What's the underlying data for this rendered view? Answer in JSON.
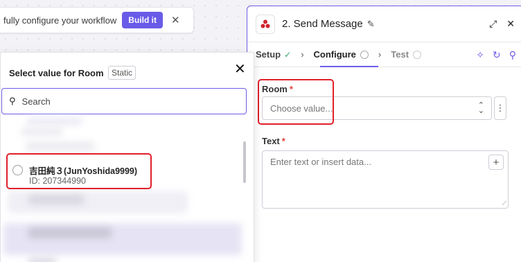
{
  "banner": {
    "text": "fully configure your workflow",
    "build_label": "Build it",
    "close_label": "✕"
  },
  "panel": {
    "step_title": "2. Send Message",
    "tabs": [
      {
        "label": "Setup",
        "state": "done"
      },
      {
        "label": "Configure",
        "state": "active"
      },
      {
        "label": "Test",
        "state": "pending"
      }
    ],
    "room_label": "Room",
    "room_placeholder": "Choose value...",
    "text_label": "Text",
    "text_placeholder": "Enter text or insert data...",
    "required_mark": "*"
  },
  "dropdown": {
    "title": "Select value for Room",
    "static_label": "Static",
    "close_label": "✕",
    "search_placeholder": "Search",
    "selected_option": {
      "name": "吉田純３(JunYoshida9999)",
      "id": "ID: 207344990"
    }
  },
  "colors": {
    "accent": "#6b5ce7",
    "highlight": "#e0202a",
    "required": "#e0423a"
  }
}
